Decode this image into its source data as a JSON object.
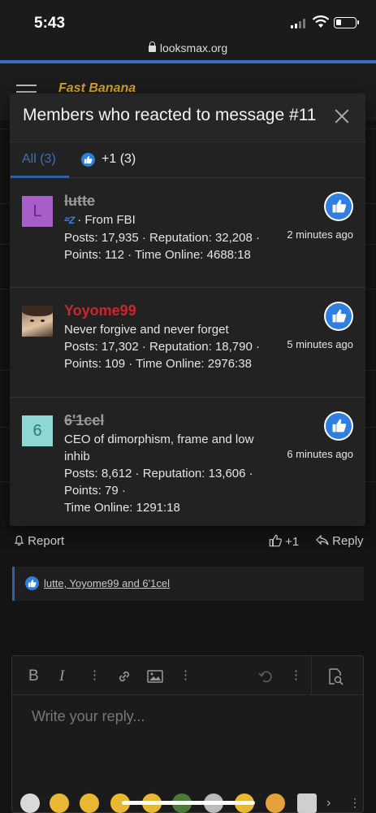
{
  "status": {
    "time": "5:43"
  },
  "browser": {
    "url": "looksmax.org"
  },
  "site": {
    "logo_text": "Fast Banana"
  },
  "modal": {
    "title": "Members who reacted to message #11",
    "tabs": [
      {
        "label": "All (3)"
      },
      {
        "label": "+1 (3)"
      }
    ],
    "members": [
      {
        "avatar_letter": "L",
        "name": "lutte",
        "title": "· From FBI",
        "stats_line1": "Posts: 17,935 · Reputation: 32,208 ·",
        "stats_line2": "Points: 112 · Time Online: 4688:18",
        "time_ago": "2 minutes ago"
      },
      {
        "avatar_letter": "",
        "name": "Yoyome99",
        "title": "Never forgive and never forget",
        "stats_line1": "Posts: 17,302 · Reputation: 18,790 ·",
        "stats_line2": "Points: 109 · Time Online: 2976:38",
        "time_ago": "5 minutes ago"
      },
      {
        "avatar_letter": "6",
        "name": "6'1cel",
        "title": "CEO of dimorphism, frame and low inhib",
        "stats_line1": "Posts: 8,612 · Reputation: 13,606 · Points: 79 ·",
        "stats_line2": "Time Online: 1291:18",
        "time_ago": "6 minutes ago"
      }
    ]
  },
  "post_actions": {
    "report": "Report",
    "plus_one": "+1",
    "reply": "Reply"
  },
  "reactions_summary": "lutte, Yoyome99 and 6'1cel",
  "editor": {
    "placeholder": "Write your reply..."
  },
  "colors": {
    "accent": "#2f7fe0",
    "tab_active": "#3e6fb8",
    "name_red": "#c8282a"
  }
}
